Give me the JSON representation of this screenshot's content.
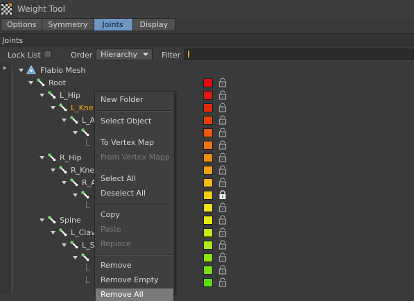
{
  "window": {
    "title": "Weight Tool"
  },
  "tabs": [
    {
      "label": "Options",
      "active": false
    },
    {
      "label": "Symmetry",
      "active": false
    },
    {
      "label": "Joints",
      "active": true
    },
    {
      "label": "Display",
      "active": false
    }
  ],
  "section": {
    "title": "Joints"
  },
  "filterbar": {
    "lock_list_label": "Lock List",
    "lock_list_checked": false,
    "order_label": "Order",
    "order_value": "Hierarchy",
    "filter_label": "Filter",
    "filter_value": ""
  },
  "tree": [
    {
      "label": "Flabio Mesh",
      "icon": "mesh-icon",
      "depth": 0,
      "color": null,
      "locked": null,
      "highlight": false
    },
    {
      "label": "Root",
      "icon": "joint-icon",
      "depth": 1,
      "color": "#e01010",
      "locked": false,
      "highlight": false
    },
    {
      "label": "L_Hip",
      "icon": "joint-icon",
      "depth": 2,
      "color": "#e01818",
      "locked": false,
      "highlight": false
    },
    {
      "label": "L_Kne",
      "icon": "joint-icon",
      "depth": 3,
      "color": "#e02a10",
      "locked": false,
      "highlight": true
    },
    {
      "label": "L_A",
      "icon": "joint-icon",
      "depth": 4,
      "color": "#e44010",
      "locked": false,
      "highlight": false
    },
    {
      "label": "",
      "icon": "joint-icon",
      "depth": 5,
      "color": "#ea5810",
      "locked": false,
      "highlight": false
    },
    {
      "label": "",
      "icon": "",
      "depth": 6,
      "color": "#ee7410",
      "locked": false,
      "highlight": false
    },
    {
      "label": "R_Hip",
      "icon": "joint-icon",
      "depth": 2,
      "color": "#f08a10",
      "locked": false,
      "highlight": false
    },
    {
      "label": "R_Kne",
      "icon": "joint-icon",
      "depth": 3,
      "color": "#f2a010",
      "locked": false,
      "highlight": false
    },
    {
      "label": "R_A",
      "icon": "joint-icon",
      "depth": 4,
      "color": "#f4b810",
      "locked": false,
      "highlight": false
    },
    {
      "label": "",
      "icon": "joint-icon",
      "depth": 5,
      "color": "#f4cc10",
      "locked": true,
      "highlight": false
    },
    {
      "label": "",
      "icon": "",
      "depth": 6,
      "color": "#f4e010",
      "locked": false,
      "highlight": false
    },
    {
      "label": "Spine",
      "icon": "joint-icon",
      "depth": 2,
      "color": "#e6ea10",
      "locked": false,
      "highlight": false
    },
    {
      "label": "L_Clav",
      "icon": "joint-icon",
      "depth": 3,
      "color": "#c8e810",
      "locked": false,
      "highlight": false
    },
    {
      "label": "L_S",
      "icon": "joint-icon",
      "depth": 4,
      "color": "#aee810",
      "locked": false,
      "highlight": false
    },
    {
      "label": "",
      "icon": "joint-icon",
      "depth": 5,
      "color": "#92e410",
      "locked": false,
      "highlight": false
    },
    {
      "label": "",
      "icon": "",
      "depth": 6,
      "color": "#78e010",
      "locked": false,
      "highlight": false
    },
    {
      "label": "",
      "icon": "",
      "depth": 6,
      "color": "#5edc10",
      "locked": false,
      "highlight": false
    }
  ],
  "context_menu": {
    "items": [
      {
        "label": "New Folder",
        "enabled": true,
        "hover": false
      },
      {
        "separator": true
      },
      {
        "label": "Select Object",
        "enabled": true,
        "hover": false
      },
      {
        "separator": true
      },
      {
        "label": "To Vertex Map",
        "enabled": true,
        "hover": false
      },
      {
        "label": "From Vertex Mapp",
        "enabled": false,
        "hover": false
      },
      {
        "separator": true
      },
      {
        "label": "Select All",
        "enabled": true,
        "hover": false
      },
      {
        "label": "Deselect All",
        "enabled": true,
        "hover": false
      },
      {
        "separator": true
      },
      {
        "label": "Copy",
        "enabled": true,
        "hover": false
      },
      {
        "label": "Paste",
        "enabled": false,
        "hover": false
      },
      {
        "label": "Replace",
        "enabled": false,
        "hover": false
      },
      {
        "separator": true
      },
      {
        "label": "Remove",
        "enabled": true,
        "hover": false
      },
      {
        "label": "Remove Empty",
        "enabled": true,
        "hover": false
      },
      {
        "label": "Remove All",
        "enabled": true,
        "hover": true
      }
    ]
  }
}
